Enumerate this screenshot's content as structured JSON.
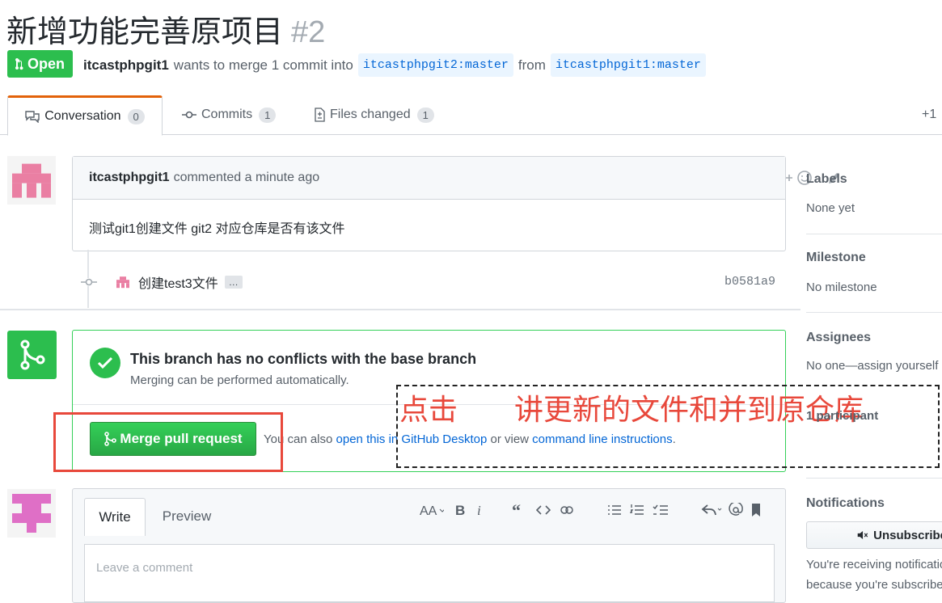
{
  "pr": {
    "title": "新增功能完善原项目",
    "number": "#2",
    "state": "Open",
    "author": "itcastphpgit1",
    "wants_to_merge": "wants to merge 1 commit into",
    "base_ref": "itcastphpgit2:master",
    "from": "from",
    "head_ref": "itcastphpgit1:master"
  },
  "tabs": [
    {
      "label": "Conversation",
      "count": "0"
    },
    {
      "label": "Commits",
      "count": "1"
    },
    {
      "label": "Files changed",
      "count": "1"
    }
  ],
  "diffstat": "+1",
  "comment": {
    "author": "itcastphpgit1",
    "meta": "commented a minute ago",
    "body": "测试git1创建文件 git2 对应仓库是否有该文件"
  },
  "commit": {
    "message": "创建test3文件",
    "ellipsis": "…",
    "sha": "b0581a9"
  },
  "merge": {
    "title": "This branch has no conflicts with the base branch",
    "subtitle": "Merging can be performed automatically.",
    "button": "Merge pull request",
    "also_prefix": "You can also",
    "desktop_link": "open this in GitHub Desktop",
    "or_view": "or view",
    "cli_link": "command line instructions",
    "period": "."
  },
  "annotation": {
    "part1": "点击",
    "part2": "讲更新的文件和并到原仓库"
  },
  "editor": {
    "tab_write": "Write",
    "tab_preview": "Preview",
    "placeholder": "Leave a comment"
  },
  "sidebar": {
    "labels_h": "Labels",
    "labels_v": "None yet",
    "milestone_h": "Milestone",
    "milestone_v": "No milestone",
    "assignees_h": "Assignees",
    "assignees_v": "No one—assign yourself",
    "participants": "1 participant",
    "notifications_h": "Notifications",
    "unsubscribe": "Unsubscribe",
    "notif_line1": "You're receiving notifications",
    "notif_line2": "because you're subscribed"
  },
  "colors": {
    "green": "#2cbe4e",
    "link": "#0366d6",
    "annotation_red": "#e8483b"
  }
}
